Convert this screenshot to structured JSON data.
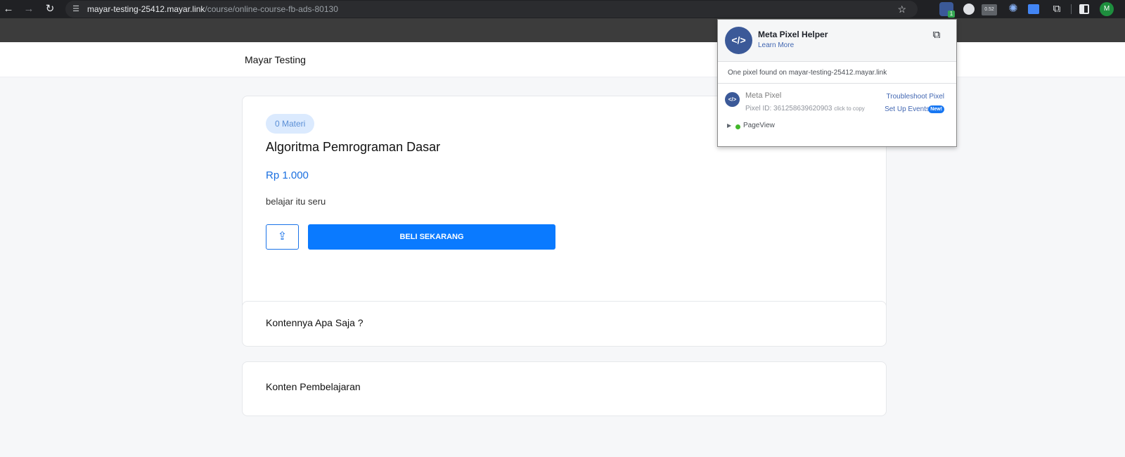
{
  "browser": {
    "url_host": "mayar-testing-25412.mayar.link",
    "url_path": "/course/online-course-fb-ads-80130",
    "icons": [
      "back-icon",
      "forward-icon",
      "reload-icon",
      "site-info-icon",
      "star-icon",
      "puzzle-icon",
      "side-panel-icon"
    ],
    "pixel_ext_badge": "1",
    "counter_ext_badge": "0.52",
    "profile_initial": "M"
  },
  "site": {
    "brand": "Mayar Testing"
  },
  "course": {
    "chip": "0 Materi",
    "title": "Algoritma Pemrograman Dasar",
    "price": "Rp 1.000",
    "description": "belajar itu seru",
    "buy_label": "BELI SEKARANG"
  },
  "sections": {
    "contents_title": "Kontennya Apa Saja ?",
    "learning_title": "Konten Pembelajaran"
  },
  "pixel_helper": {
    "title": "Meta Pixel Helper",
    "learn_more": "Learn More",
    "found_text": "One pixel found on mayar-testing-25412.mayar.link",
    "pixel_name": "Meta Pixel",
    "pixel_id": "Pixel ID: 361258639620903",
    "click_to_copy": "click to copy",
    "troubleshoot": "Troubleshoot Pixel",
    "setup_events": "Set Up Events",
    "new_badge": "New!",
    "event": "PageView"
  },
  "colors": {
    "accent": "#0a7aff",
    "price": "#1a6fe0",
    "chip_bg": "#dbeafe",
    "meta_blue": "#3b5998",
    "success": "#42b72a"
  }
}
